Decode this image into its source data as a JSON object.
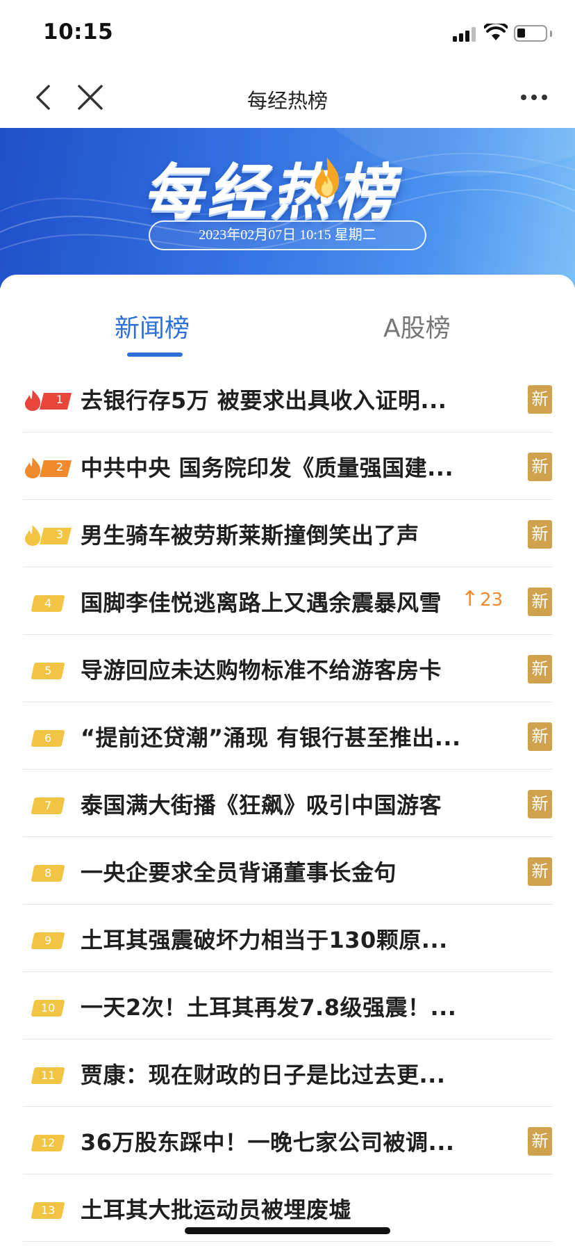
{
  "status_bar": {
    "time": "10:15"
  },
  "nav": {
    "title": "每经热榜"
  },
  "banner": {
    "title": "每经热榜",
    "datetime": "2023年02月07日 10:15 星期二"
  },
  "tabs": [
    {
      "label": "新闻榜",
      "active": true
    },
    {
      "label": "A股榜",
      "active": false
    }
  ],
  "new_badge_label": "新",
  "colors": {
    "accent": "#2d6fd9",
    "rank1": "#e8453b",
    "rank2": "#f08a2c",
    "rank3": "#f4c542",
    "rank_default": "#f2c443",
    "new_badge": "#d0a24d",
    "rise": "#f08a2c"
  },
  "items": [
    {
      "rank": "1",
      "title": "去银行存5万 被要求出具收入证明...",
      "new": true
    },
    {
      "rank": "2",
      "title": "中共中央 国务院印发《质量强国建...",
      "new": true
    },
    {
      "rank": "3",
      "title": "男生骑车被劳斯莱斯撞倒笑出了声",
      "new": true
    },
    {
      "rank": "4",
      "title": "国脚李佳悦逃离路上又遇余震暴风雪",
      "new": true,
      "rise": "23"
    },
    {
      "rank": "5",
      "title": "导游回应未达购物标准不给游客房卡",
      "new": true
    },
    {
      "rank": "6",
      "title": "“提前还贷潮”涌现 有银行甚至推出...",
      "new": true
    },
    {
      "rank": "7",
      "title": "泰国满大街播《狂飙》吸引中国游客",
      "new": true
    },
    {
      "rank": "8",
      "title": "一央企要求全员背诵董事长金句",
      "new": true
    },
    {
      "rank": "9",
      "title": "土耳其强震破坏力相当于130颗原...",
      "new": false
    },
    {
      "rank": "10",
      "title": "一天2次！土耳其再发7.8级强震！...",
      "new": false
    },
    {
      "rank": "11",
      "title": "贾康：现在财政的日子是比过去更...",
      "new": false
    },
    {
      "rank": "12",
      "title": "36万股东踩中！一晚七家公司被调...",
      "new": true
    },
    {
      "rank": "13",
      "title": "土耳其大批运动员被埋废墟",
      "new": false
    }
  ]
}
